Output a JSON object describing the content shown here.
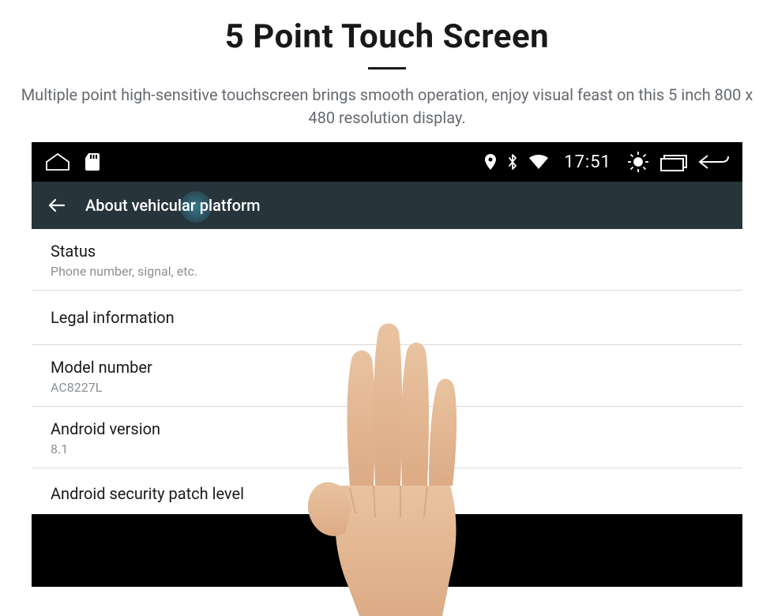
{
  "hero": {
    "title": "5 Point Touch Screen",
    "subtitle": "Multiple point high-sensitive touchscreen brings smooth operation, enjoy visual feast on this 5 inch 800 x 480 resolution display."
  },
  "status": {
    "time": "17:51"
  },
  "titlebar": {
    "title": "About vehicular platform"
  },
  "rows": [
    {
      "title": "Status",
      "sub": "Phone number, signal, etc."
    },
    {
      "title": "Legal information",
      "sub": ""
    },
    {
      "title": "Model number",
      "sub": "AC8227L"
    },
    {
      "title": "Android version",
      "sub": "8.1"
    },
    {
      "title": "Android security patch level",
      "sub": ""
    }
  ]
}
